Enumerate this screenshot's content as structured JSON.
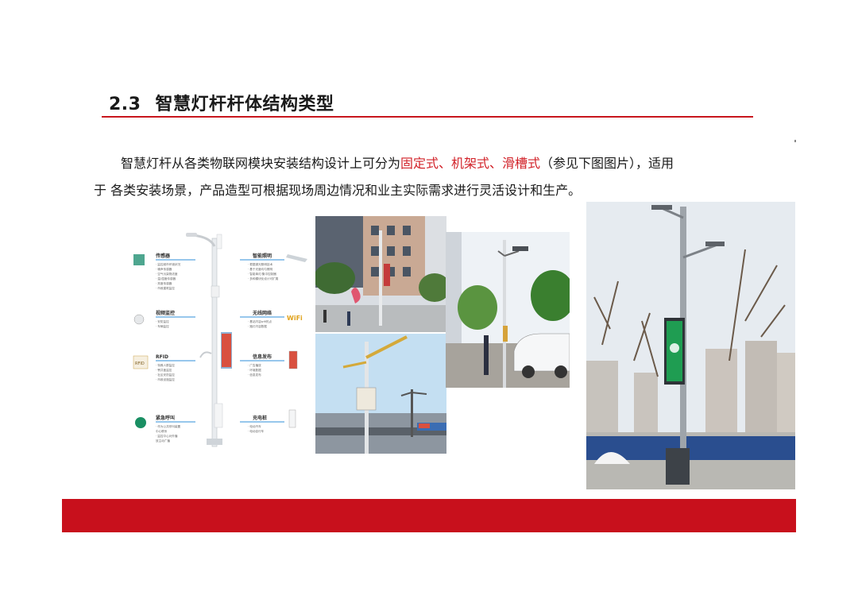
{
  "slide": {
    "section_number": "2.3",
    "title": "智慧灯杆杆体结构类型",
    "para1_before": "智慧灯杆从各类物联网模块安装结构设计上可分为",
    "para1_highlight": "固定式、机架式、滑槽式",
    "para1_after": "（参见下图图片），适用",
    "para2": "于 各类安装场景，产品造型可根据现场周边情况和业主实际需求进行灵活设计和生产。",
    "colors": {
      "accent_red": "#c8161d",
      "highlight_red": "#d2232a",
      "line_blue": "#2f8fd8"
    }
  },
  "diagram": {
    "left_modules": [
      {
        "name": "传感器",
        "items": [
          "· 监控城市环境状况",
          "· 噪声传感器",
          "· 空气污染物浓度",
          "· 温/湿度传感器",
          "· 亮度传感器",
          "· 市政建筑监控"
        ]
      },
      {
        "name": "视频监控",
        "items": [
          "· 安防监控",
          "· 车辆监控"
        ]
      },
      {
        "name": "RFID",
        "items": [
          "· 特殊人群监控",
          "· 窨井盖监控",
          "· 社区安防监控",
          "· 市政设施监控"
        ]
      },
      {
        "name": "紧急呼叫",
        "items": [
          "· 作为公共呼叫装置",
          "  中心联系",
          "· 监控中心对外播",
          "  放主动广播"
        ]
      }
    ],
    "right_modules": [
      {
        "name": "智能照明",
        "items": [
          "· 根据调光照明技术",
          "· 基于光度均匀照明",
          "· 智能单灯/集中控制器",
          "· 多种模块化设计可扩展"
        ]
      },
      {
        "name": "无线网络",
        "items": [
          "· 基站内容wifi热点",
          "· 路灯内容数据"
        ]
      },
      {
        "name": "信息发布",
        "items": [
          "· 广告播放",
          "· 环境数据",
          "· 信息发布"
        ]
      },
      {
        "name": "充电桩",
        "items": [
          "· 电动汽车",
          "· 电动自行车"
        ]
      }
    ],
    "icon_labels": {
      "wifi": "WiFi",
      "rfid": "RFID"
    }
  }
}
